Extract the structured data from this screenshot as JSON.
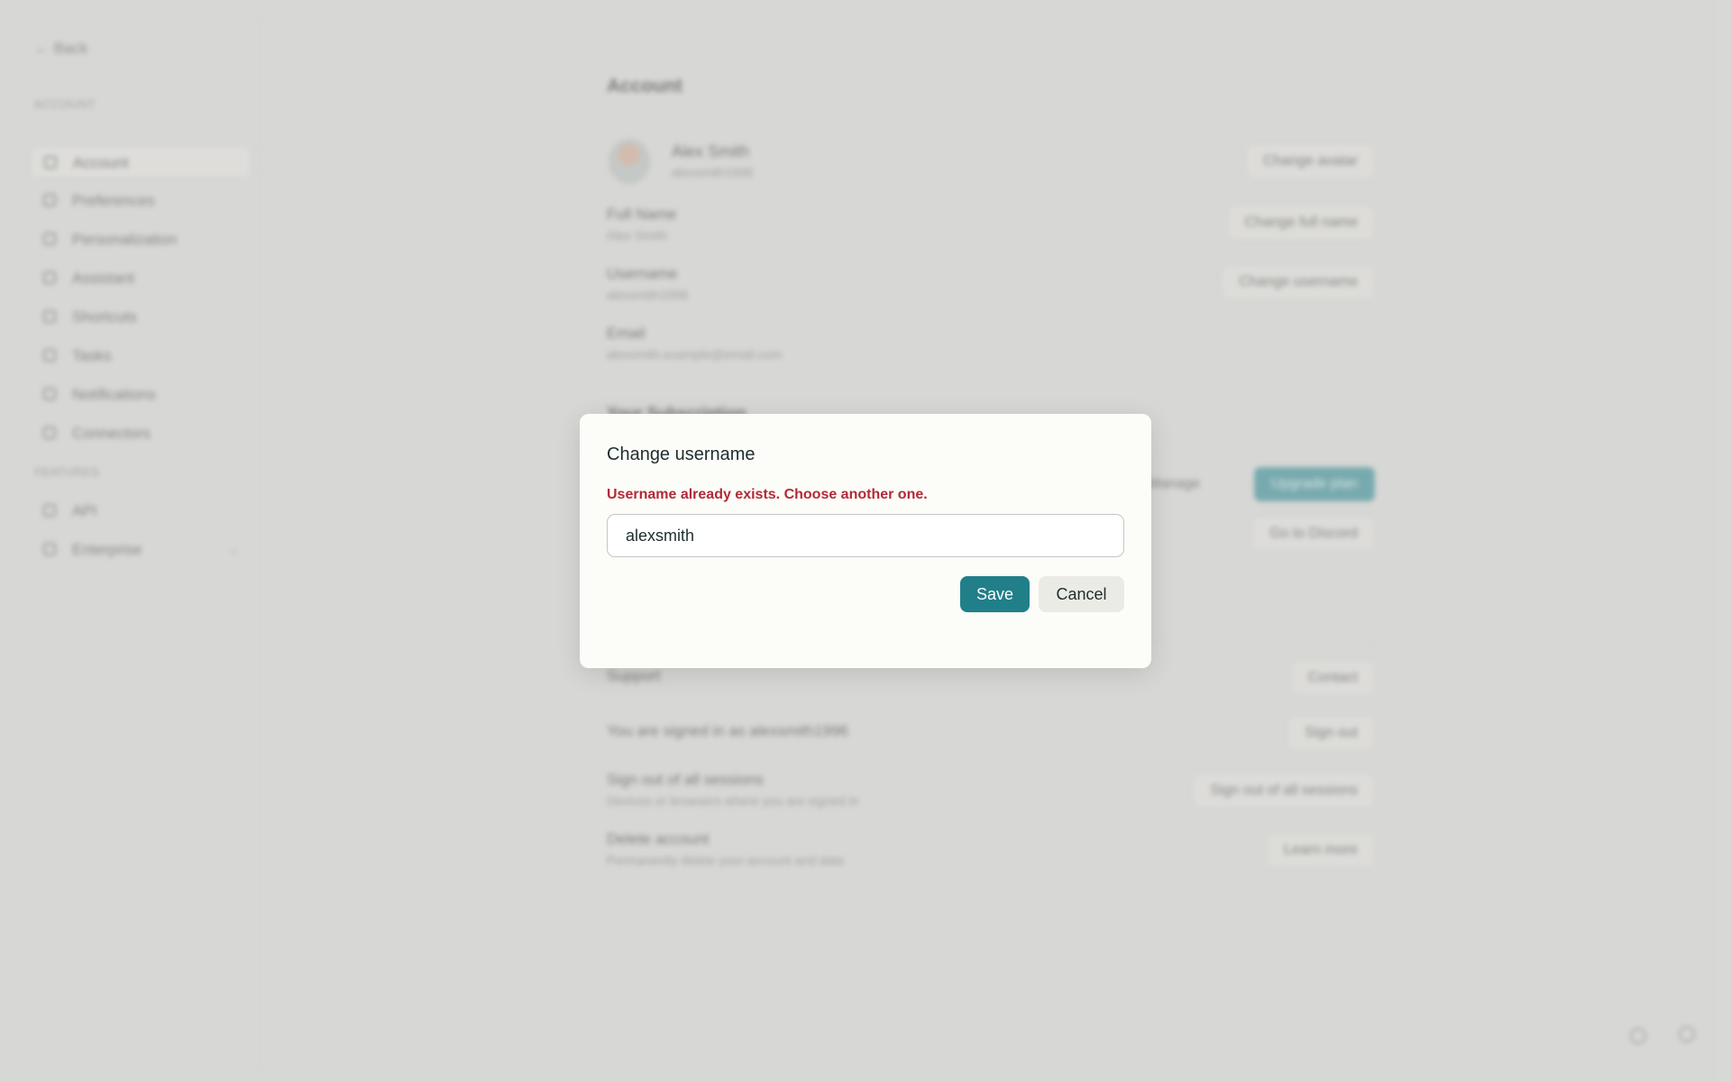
{
  "sidebar": {
    "back_label": "← Back",
    "section1": "ACCOUNT",
    "section2": "FEATURES",
    "items": [
      {
        "label": "Account"
      },
      {
        "label": "Preferences"
      },
      {
        "label": "Personalization"
      },
      {
        "label": "Assistant"
      },
      {
        "label": "Shortcuts"
      },
      {
        "label": "Tasks"
      },
      {
        "label": "Notifications"
      },
      {
        "label": "Connectors"
      },
      {
        "label": "API"
      },
      {
        "label": "Enterprise"
      }
    ]
  },
  "account": {
    "title": "Account",
    "profile_name": "Alex Smith",
    "profile_handle": "alexsmith1996",
    "change_avatar": "Change avatar",
    "fullname_label": "Full Name",
    "fullname_value": "Alex Smith",
    "change_fullname": "Change full name",
    "username_label": "Username",
    "username_value": "alexsmith1996",
    "change_username": "Change username",
    "email_label": "Email",
    "email_value": "alexsmith.example@email.com",
    "subscription_label": "Your Subscription",
    "manage_label": "Manage",
    "upgrade_label": "Upgrade plan",
    "go_to_label": "Go to Discord",
    "support_label": "Support",
    "contact_label": "Contact",
    "signed_in_text": "You are signed in as alexsmith1996",
    "sign_out": "Sign out",
    "signout_all_label": "Sign out of all sessions",
    "signout_all_desc": "Devices or browsers where you are signed in",
    "signout_all_btn": "Sign out of all sessions",
    "delete_label": "Delete account",
    "delete_desc": "Permanently delete your account and data",
    "learn_more": "Learn more"
  },
  "modal": {
    "title": "Change username",
    "error": "Username already exists. Choose another one.",
    "input_value": "alexsmith",
    "save_label": "Save",
    "cancel_label": "Cancel"
  },
  "colors": {
    "accent": "#217f89",
    "error": "#b22a37",
    "background": "#dcdcda",
    "modal": "#fcfcf8"
  }
}
